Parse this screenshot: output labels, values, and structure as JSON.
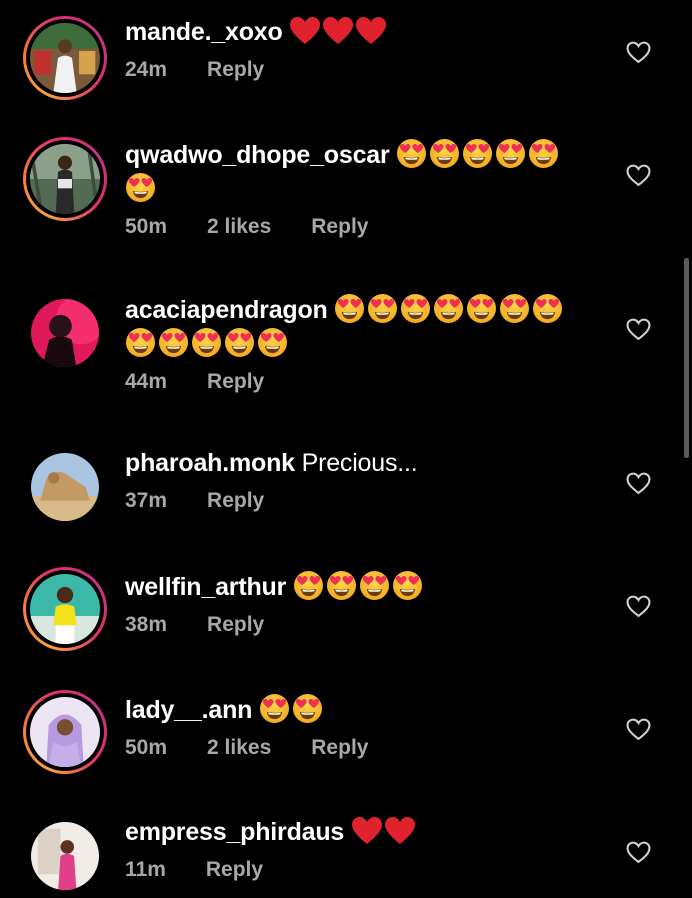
{
  "comments": [
    {
      "username": "mande._xoxo",
      "text": "",
      "reactions": "heart-x3",
      "time": "24m",
      "likes": "",
      "reply": "Reply",
      "story_ring": true
    },
    {
      "username": "qwadwo_dhope_oscar",
      "text": "",
      "reactions": "heart-eyes-x6",
      "time": "50m",
      "likes": "2 likes",
      "reply": "Reply",
      "story_ring": true
    },
    {
      "username": "acaciapendragon",
      "text": "",
      "reactions": "heart-eyes-x12",
      "time": "44m",
      "likes": "",
      "reply": "Reply",
      "story_ring": false
    },
    {
      "username": "pharoah.monk",
      "text": "Precious...",
      "reactions": "",
      "time": "37m",
      "likes": "",
      "reply": "Reply",
      "story_ring": false
    },
    {
      "username": "wellfin_arthur",
      "text": "",
      "reactions": "heart-eyes-x4",
      "time": "38m",
      "likes": "",
      "reply": "Reply",
      "story_ring": true
    },
    {
      "username": "lady__.ann",
      "text": "",
      "reactions": "heart-eyes-x2",
      "time": "50m",
      "likes": "2 likes",
      "reply": "Reply",
      "story_ring": true
    },
    {
      "username": "empress_phirdaus",
      "text": "",
      "reactions": "heart-x2",
      "time": "11m",
      "likes": "",
      "reply": "Reply",
      "story_ring": false
    }
  ],
  "colors": {
    "background": "#000000",
    "text": "#ffffff",
    "meta_text": "#a8a8a8",
    "heart_red": "#e0212e",
    "emoji_yellow": "#f7c331",
    "ring_orange": "#f9a03f",
    "ring_pink": "#e1306c"
  },
  "icons": {
    "like": "heart-outline-icon"
  }
}
